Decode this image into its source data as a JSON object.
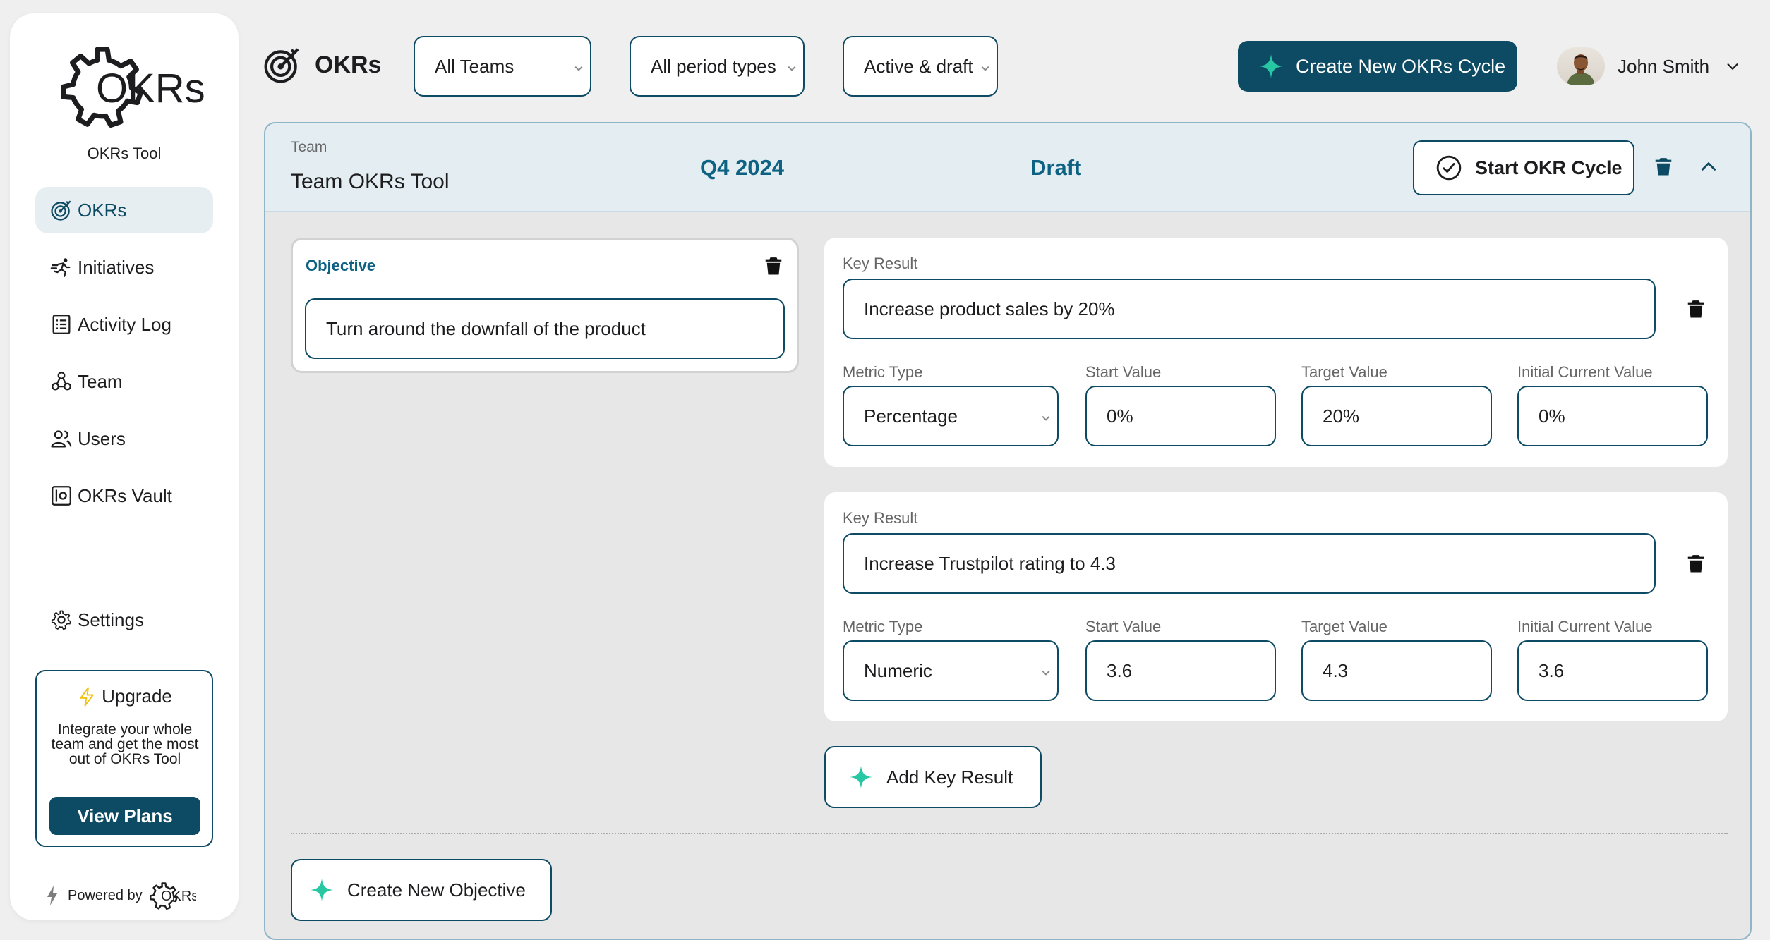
{
  "colors": {
    "primary": "#0d4a63",
    "accent": "#27c7a3",
    "highlight": "#0d6284"
  },
  "sidebar": {
    "logo_text": "OKRs",
    "subtitle": "OKRs Tool",
    "items": [
      {
        "label": "OKRs",
        "icon": "target-icon",
        "active": true
      },
      {
        "label": "Initiatives",
        "icon": "runner-icon"
      },
      {
        "label": "Activity Log",
        "icon": "list-icon"
      },
      {
        "label": "Team",
        "icon": "team-icon"
      },
      {
        "label": "Users",
        "icon": "users-icon"
      },
      {
        "label": "OKRs Vault",
        "icon": "vault-icon"
      }
    ],
    "settings_label": "Settings",
    "upgrade": {
      "title": "Upgrade",
      "text": "Integrate your whole team and get the most out of OKRs Tool",
      "button": "View Plans"
    },
    "powered_by": "Powered by",
    "powered_logo": "OKRs"
  },
  "header": {
    "title": "OKRs",
    "filters": {
      "team": "All Teams",
      "period_type": "All period types",
      "status": "Active & draft"
    },
    "create_cycle": "Create New OKRs Cycle",
    "user_name": "John Smith"
  },
  "cycle": {
    "team_label": "Team",
    "team_name": "Team OKRs Tool",
    "period": "Q4 2024",
    "status": "Draft",
    "start_button": "Start OKR Cycle",
    "objective": {
      "label": "Objective",
      "value": "Turn around the downfall of the product"
    },
    "field_labels": {
      "key_result": "Key Result",
      "metric_type": "Metric Type",
      "start_value": "Start Value",
      "target_value": "Target Value",
      "initial_current": "Initial Current Value"
    },
    "key_results": [
      {
        "title": "Increase product sales by 20%",
        "metric_type": "Percentage",
        "start": "0%",
        "target": "20%",
        "current": "0%"
      },
      {
        "title": "Increase Trustpilot rating to 4.3",
        "metric_type": "Numeric",
        "start": "3.6",
        "target": "4.3",
        "current": "3.6"
      }
    ],
    "add_key_result": "Add Key Result",
    "create_objective": "Create New Objective"
  }
}
